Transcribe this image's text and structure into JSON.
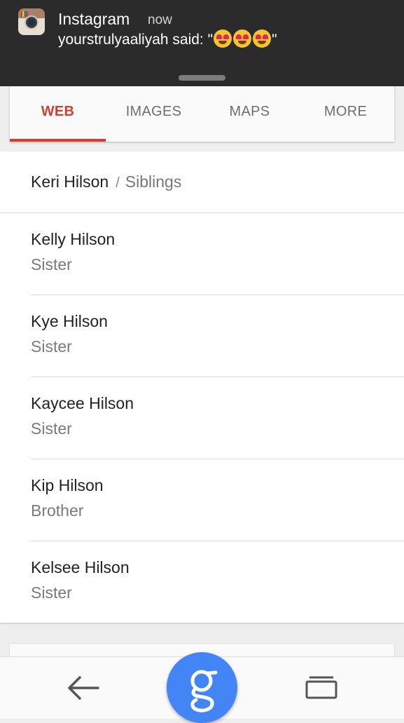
{
  "notification": {
    "app_name": "Instagram",
    "time": "now",
    "message": "yourstrulyaaliyah said: \"",
    "message_end": "\"",
    "app_icon": "instagram-app-icon",
    "emoji": "heart-eyes-emoji",
    "emoji_count": 3
  },
  "tabs": [
    {
      "label": "WEB",
      "active": true
    },
    {
      "label": "IMAGES",
      "active": false
    },
    {
      "label": "MAPS",
      "active": false
    },
    {
      "label": "MORE",
      "active": false
    }
  ],
  "breadcrumb": {
    "entity": "Keri Hilson",
    "separator": "/",
    "category": "Siblings"
  },
  "siblings": [
    {
      "name": "Kelly Hilson",
      "relation": "Sister"
    },
    {
      "name": "Kye Hilson",
      "relation": "Sister"
    },
    {
      "name": "Kaycee Hilson",
      "relation": "Sister"
    },
    {
      "name": "Kip Hilson",
      "relation": "Brother"
    },
    {
      "name": "Kelsee Hilson",
      "relation": "Sister"
    }
  ],
  "bottom_nav": {
    "back_icon": "back-arrow-icon",
    "search_icon": "google-g-icon",
    "recents_icon": "recents-icon"
  },
  "colors": {
    "accent": "#d23f31",
    "google_blue": "#4385f4",
    "notification_bg": "#2b2b2b"
  }
}
